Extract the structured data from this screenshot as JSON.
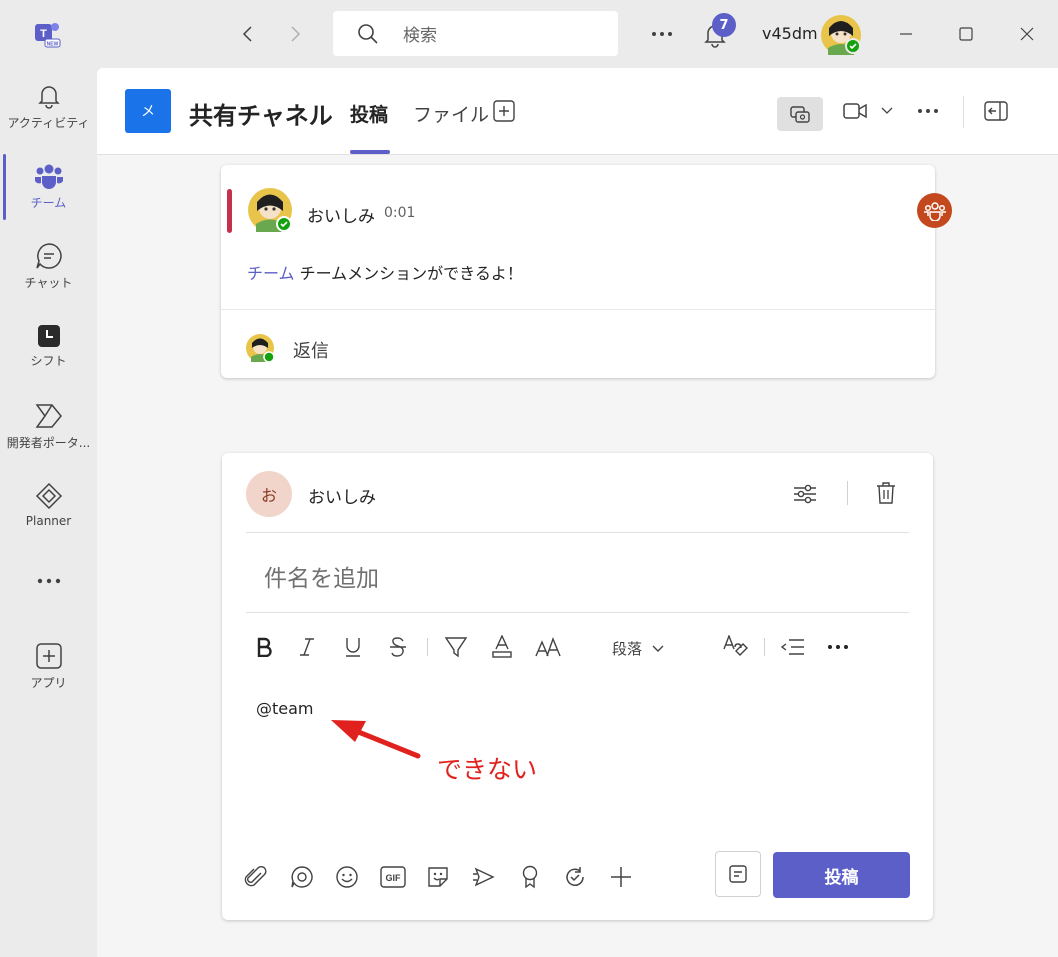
{
  "titlebar": {
    "search_placeholder": "検索",
    "notification_count": "7",
    "username": "v45dm"
  },
  "rail": {
    "items": [
      {
        "label": "アクティビティ",
        "icon": "bell-icon"
      },
      {
        "label": "チーム",
        "icon": "teams-icon"
      },
      {
        "label": "チャット",
        "icon": "chat-icon"
      },
      {
        "label": "シフト",
        "icon": "shifts-icon"
      },
      {
        "label": "開発者ポータ...",
        "icon": "developer-portal-icon"
      },
      {
        "label": "Planner",
        "icon": "planner-icon"
      },
      {
        "label": "アプリ",
        "icon": "apps-icon"
      }
    ]
  },
  "header": {
    "channel_initial": "メ",
    "channel_title": "共有チャネル",
    "tabs": [
      {
        "label": "投稿",
        "active": true
      },
      {
        "label": "ファイル",
        "active": false
      }
    ]
  },
  "message": {
    "author": "おいしみ",
    "time": "0:01",
    "mention": "チーム",
    "body": " チームメンションができるよ！",
    "reply_label": "返信"
  },
  "compose": {
    "avatar_initial": "お",
    "author": "おいしみ",
    "subject_placeholder": "件名を追加",
    "paragraph_label": "段落",
    "editor_text": "@team",
    "post_label": "投稿"
  },
  "annotation": {
    "text": "できない",
    "color": "#e0211d"
  },
  "colors": {
    "accent": "#5b5fc7",
    "channel_avatar": "#1a73e8",
    "message_accent": "#c4314b"
  }
}
